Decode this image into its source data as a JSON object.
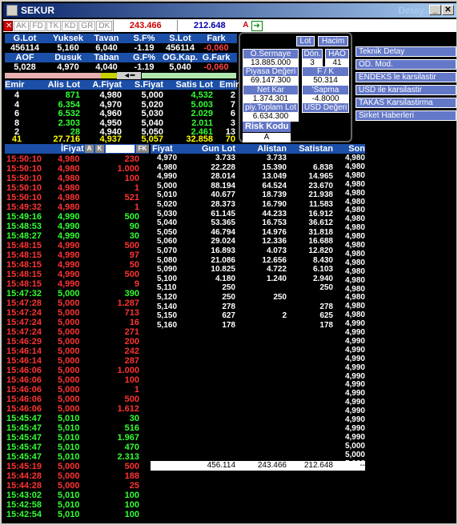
{
  "window": {
    "title": "SEKUR",
    "right_title": "Detay",
    "min": "_",
    "max": "□",
    "close": "✕"
  },
  "toolbar": {
    "buttons": [
      "AK",
      "FD",
      "TK",
      "KD",
      "GR",
      "DK"
    ],
    "value1": "243.466",
    "value2": "212.648",
    "a_btn": "A"
  },
  "summary": {
    "row1_labels": [
      "G.Lot",
      "Yuksek",
      "Tavan",
      "S.F%",
      "S.Lot",
      "Fark"
    ],
    "row1_values": [
      "456114",
      "5,160",
      "6,040",
      "-1.19",
      "456114",
      "-0,060"
    ],
    "row2_labels": [
      "AOF",
      "Dusuk",
      "Taban",
      "G.F%",
      "OG.Kap.",
      "G.Fark"
    ],
    "row2_values": [
      "5,028",
      "4,970",
      "4,040",
      "-1.19",
      "5,040",
      "-0,060"
    ]
  },
  "depth": {
    "headers": [
      "Emir",
      "Alis Lot",
      "A.Fiyat",
      "S.Fiyat",
      "Satis Lot",
      "Emir"
    ],
    "rows": [
      [
        "4",
        "871",
        "4,980",
        "5,000",
        "4,532",
        "2"
      ],
      [
        "4",
        "6.354",
        "4,970",
        "5,020",
        "5.003",
        "7"
      ],
      [
        "6",
        "6.532",
        "4,960",
        "5,030",
        "2.029",
        "6"
      ],
      [
        "8",
        "2.303",
        "4,950",
        "5,040",
        "2.011",
        "3"
      ],
      [
        "2",
        "28",
        "4,940",
        "5,050",
        "2.461",
        "13"
      ]
    ],
    "totals": [
      "41",
      "27.716",
      "4,937",
      "5,057",
      "32.858",
      "70"
    ]
  },
  "info_panel": {
    "buttons": [
      "Lot",
      "Hacim"
    ],
    "fields": [
      {
        "label": "Ö.Sermaye",
        "value": "13.885.000"
      },
      {
        "label": "Dön.",
        "value": "3"
      },
      {
        "label": "HAO",
        "value": "41"
      },
      {
        "label": "Piyasa Değeri",
        "value": "69.147.300"
      },
      {
        "label": "F / K",
        "value": "50.314"
      },
      {
        "label": "Net Kar",
        "value": "1.374.301"
      },
      {
        "label": "'Sapma",
        "value": "-4.8000"
      },
      {
        "label": "piy.Toplam Lot",
        "value": "6.634.300"
      },
      {
        "label": "USD Değeri",
        "value": ""
      }
    ],
    "risk_label": "Risk Kodu",
    "risk_value": "A"
  },
  "side_menu": [
    "Teknik Detay",
    "OD. Mod.",
    "ENDEKS le karsilastir",
    "USD ile karsilastir",
    "TAKAS Karsilastirma",
    "Sirket Haberleri"
  ],
  "trades": {
    "headers": [
      "İFiyat",
      "A",
      "K",
      "FK"
    ],
    "rows": [
      [
        "15:50:10",
        "4,980",
        "230",
        "r"
      ],
      [
        "15:50:10",
        "4,980",
        "1.000",
        "r"
      ],
      [
        "15:50:10",
        "4,980",
        "100",
        "r"
      ],
      [
        "15:50:10",
        "4,980",
        "1",
        "r"
      ],
      [
        "15:50:10",
        "4,980",
        "521",
        "r"
      ],
      [
        "15:49:32",
        "4,980",
        "1",
        "r"
      ],
      [
        "15:49:16",
        "4,990",
        "500",
        "g"
      ],
      [
        "15:48:53",
        "4,990",
        "90",
        "g"
      ],
      [
        "15:48:27",
        "4,990",
        "30",
        "g"
      ],
      [
        "15:48:15",
        "4,990",
        "500",
        "r"
      ],
      [
        "15:48:15",
        "4,990",
        "97",
        "r"
      ],
      [
        "15:48:15",
        "4,990",
        "50",
        "r"
      ],
      [
        "15:48:15",
        "4,990",
        "500",
        "r"
      ],
      [
        "15:48:15",
        "4,990",
        "9",
        "r"
      ],
      [
        "15:47:32",
        "5,000",
        "390",
        "g"
      ],
      [
        "15:47:28",
        "5,000",
        "1.287",
        "r"
      ],
      [
        "15:47:24",
        "5,000",
        "713",
        "r"
      ],
      [
        "15:47:24",
        "5,000",
        "16",
        "r"
      ],
      [
        "15:47:24",
        "5,000",
        "271",
        "r"
      ],
      [
        "15:46:29",
        "5,000",
        "200",
        "r"
      ],
      [
        "15:46:14",
        "5,000",
        "242",
        "r"
      ],
      [
        "15:46:14",
        "5,000",
        "287",
        "r"
      ],
      [
        "15:46:06",
        "5,000",
        "1.000",
        "r"
      ],
      [
        "15:46:06",
        "5,000",
        "100",
        "r"
      ],
      [
        "15:46:06",
        "5,000",
        "1",
        "r"
      ],
      [
        "15:46:06",
        "5,000",
        "500",
        "r"
      ],
      [
        "15:46:06",
        "5,000",
        "1.612",
        "r"
      ],
      [
        "15:45:47",
        "5,010",
        "30",
        "g"
      ],
      [
        "15:45:47",
        "5,010",
        "516",
        "g"
      ],
      [
        "15:45:47",
        "5,010",
        "1.967",
        "g"
      ],
      [
        "15:45:47",
        "5,010",
        "470",
        "g"
      ],
      [
        "15:45:47",
        "5,010",
        "2.313",
        "g"
      ],
      [
        "15:45:19",
        "5,000",
        "500",
        "r"
      ],
      [
        "15:44:28",
        "5,000",
        "188",
        "r"
      ],
      [
        "15:44:28",
        "5,000",
        "25",
        "r"
      ],
      [
        "15:43:02",
        "5,010",
        "100",
        "g"
      ],
      [
        "15:42:58",
        "5,010",
        "100",
        "g"
      ],
      [
        "15:42:54",
        "5,010",
        "100",
        "g"
      ]
    ]
  },
  "distribution": {
    "headers": [
      "Fiyat",
      "Gun Lot",
      "Alistan",
      "Satistan",
      "Son"
    ],
    "rows": [
      [
        "4,970",
        "3.733",
        "3.733",
        "",
        ""
      ],
      [
        "4,980",
        "22.228",
        "15.390",
        "6.838",
        ""
      ],
      [
        "4,990",
        "28.014",
        "13.049",
        "14.965",
        ""
      ],
      [
        "5,000",
        "88.194",
        "64.524",
        "23.670",
        ""
      ],
      [
        "5,010",
        "40.677",
        "18.739",
        "21.938",
        ""
      ],
      [
        "5,020",
        "28.373",
        "16.790",
        "11.583",
        ""
      ],
      [
        "5,030",
        "61.145",
        "44.233",
        "16.912",
        ""
      ],
      [
        "5,040",
        "53.365",
        "16.753",
        "36.612",
        ""
      ],
      [
        "5,050",
        "46.794",
        "14.976",
        "31.818",
        ""
      ],
      [
        "5,060",
        "29.024",
        "12.336",
        "16.688",
        ""
      ],
      [
        "5,070",
        "16.893",
        "4.073",
        "12.820",
        ""
      ],
      [
        "5,080",
        "21.086",
        "12.656",
        "8.430",
        ""
      ],
      [
        "5,090",
        "10.825",
        "4.722",
        "6.103",
        ""
      ],
      [
        "5,100",
        "4.180",
        "1.240",
        "2.940",
        ""
      ],
      [
        "5,110",
        "250",
        "",
        "250",
        ""
      ],
      [
        "5,120",
        "250",
        "250",
        "",
        ""
      ],
      [
        "5,140",
        "278",
        "",
        "278",
        ""
      ],
      [
        "5,150",
        "627",
        "2",
        "625",
        ""
      ],
      [
        "5,160",
        "178",
        "",
        "178",
        ""
      ]
    ],
    "son": [
      "4,980",
      "4,980",
      "4,980",
      "4,980",
      "4,980",
      "4,980",
      "4,980",
      "4,980",
      "4,980",
      "4,980",
      "4,980",
      "4,980",
      "4,980",
      "4,980",
      "4,980",
      "4,980",
      "4,980",
      "4,980",
      "4,980",
      "4,990",
      "4,990",
      "4,990",
      "4,990",
      "4,990",
      "4,990",
      "4,990",
      "4,990",
      "4,990",
      "4,990",
      "4,990",
      "4,990",
      "4,990",
      "4,990",
      "5,000",
      "5,000",
      "5,000"
    ],
    "totals": [
      "",
      "456.114",
      "243.466",
      "212.648",
      "--"
    ]
  }
}
